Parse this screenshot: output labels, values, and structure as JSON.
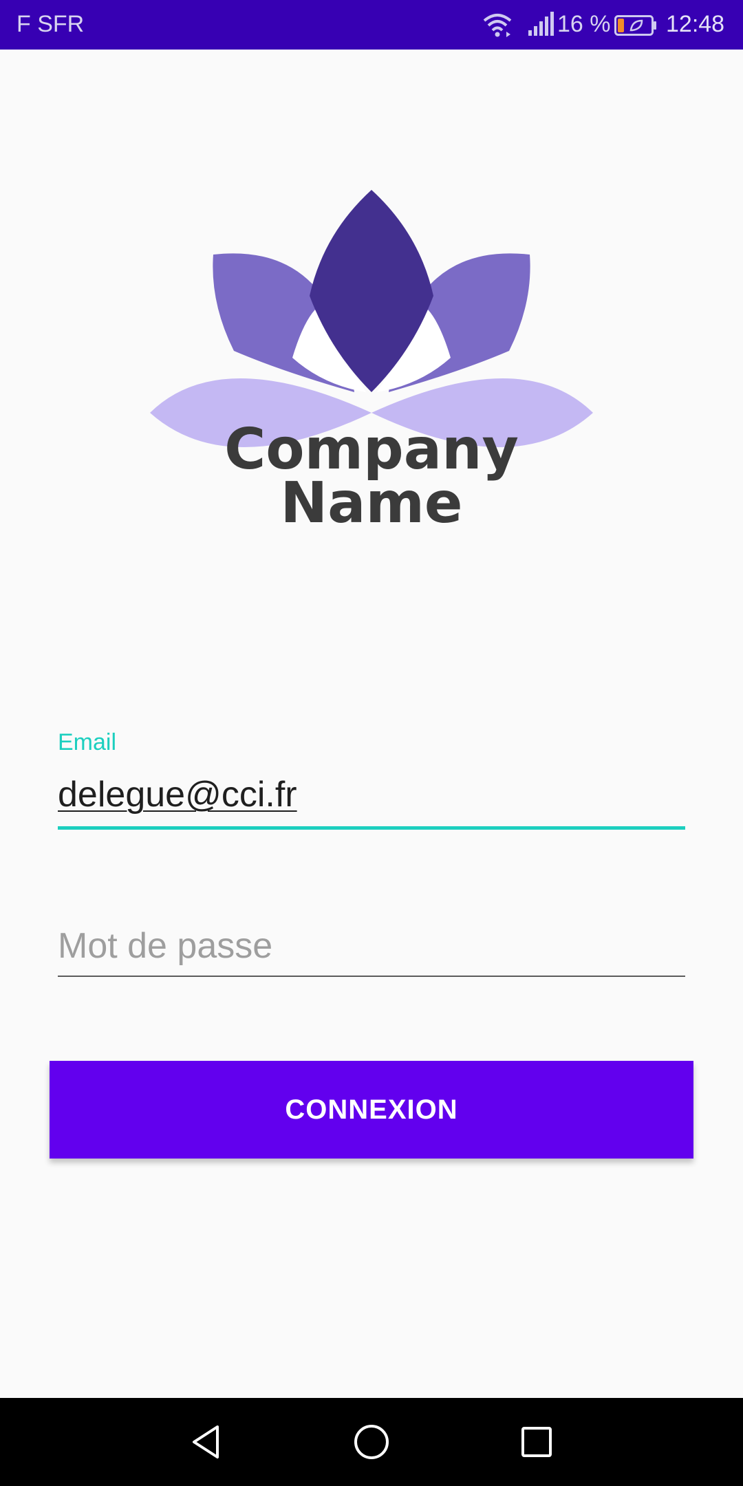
{
  "status_bar": {
    "carrier": "F SFR",
    "battery_percent": "16 %",
    "time": "12:48",
    "icons": [
      "wifi-icon",
      "signal-icon",
      "battery-icon"
    ]
  },
  "logo": {
    "line1": "Company",
    "line2": "Name"
  },
  "form": {
    "email_label": "Email",
    "email_value": "delegue@cci.fr",
    "password_placeholder": "Mot de passe"
  },
  "login_button": {
    "label": "CONNEXION"
  },
  "nav_bar": {
    "icons": [
      "back-icon",
      "home-icon",
      "recent-apps-icon"
    ]
  },
  "colors": {
    "status_bar": "#3700b3",
    "accent_teal": "#1ccfbf",
    "button": "#6200ee",
    "logo_dark": "#43308f",
    "logo_mid": "#7b6bc6",
    "logo_light": "#c4b8f3"
  }
}
